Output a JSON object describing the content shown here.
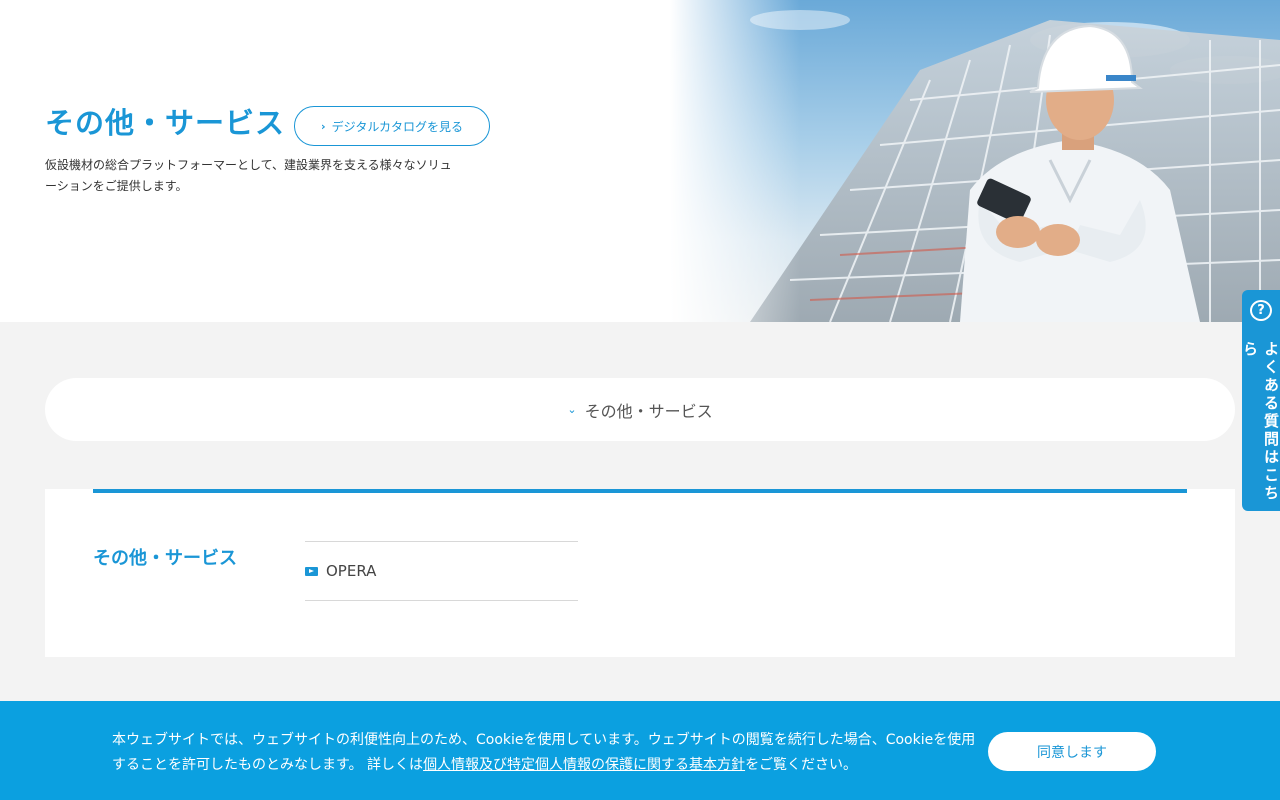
{
  "hero": {
    "title": "その他・サービス",
    "catalog_button": "デジタルカタログを見る",
    "description": "仮設機材の総合プラットフォーマーとして、建設業界を支える様々なソリューションをご提供します。"
  },
  "accordion": {
    "label": "その他・サービス"
  },
  "section": {
    "heading": "その他・サービス",
    "items": [
      {
        "label": "OPERA",
        "icon": "video-icon"
      }
    ]
  },
  "faq_tab": {
    "icon": "question-circle-icon",
    "label": "よくある質問はこちら"
  },
  "cookie": {
    "text_before": "本ウェブサイトでは、ウェブサイトの利便性向上のため、Cookieを使用しています。ウェブサイトの閲覧を続行した場合、Cookieを使用することを許可したものとみなします。 詳しくは",
    "link": "個人情報及び特定個人情報の保護に関する基本方針",
    "text_after": "をご覧ください。",
    "agree_button": "同意します"
  },
  "colors": {
    "accent": "#1a96d6",
    "cookie_bg": "#0ba0e0",
    "page_bg": "#f3f3f3"
  }
}
